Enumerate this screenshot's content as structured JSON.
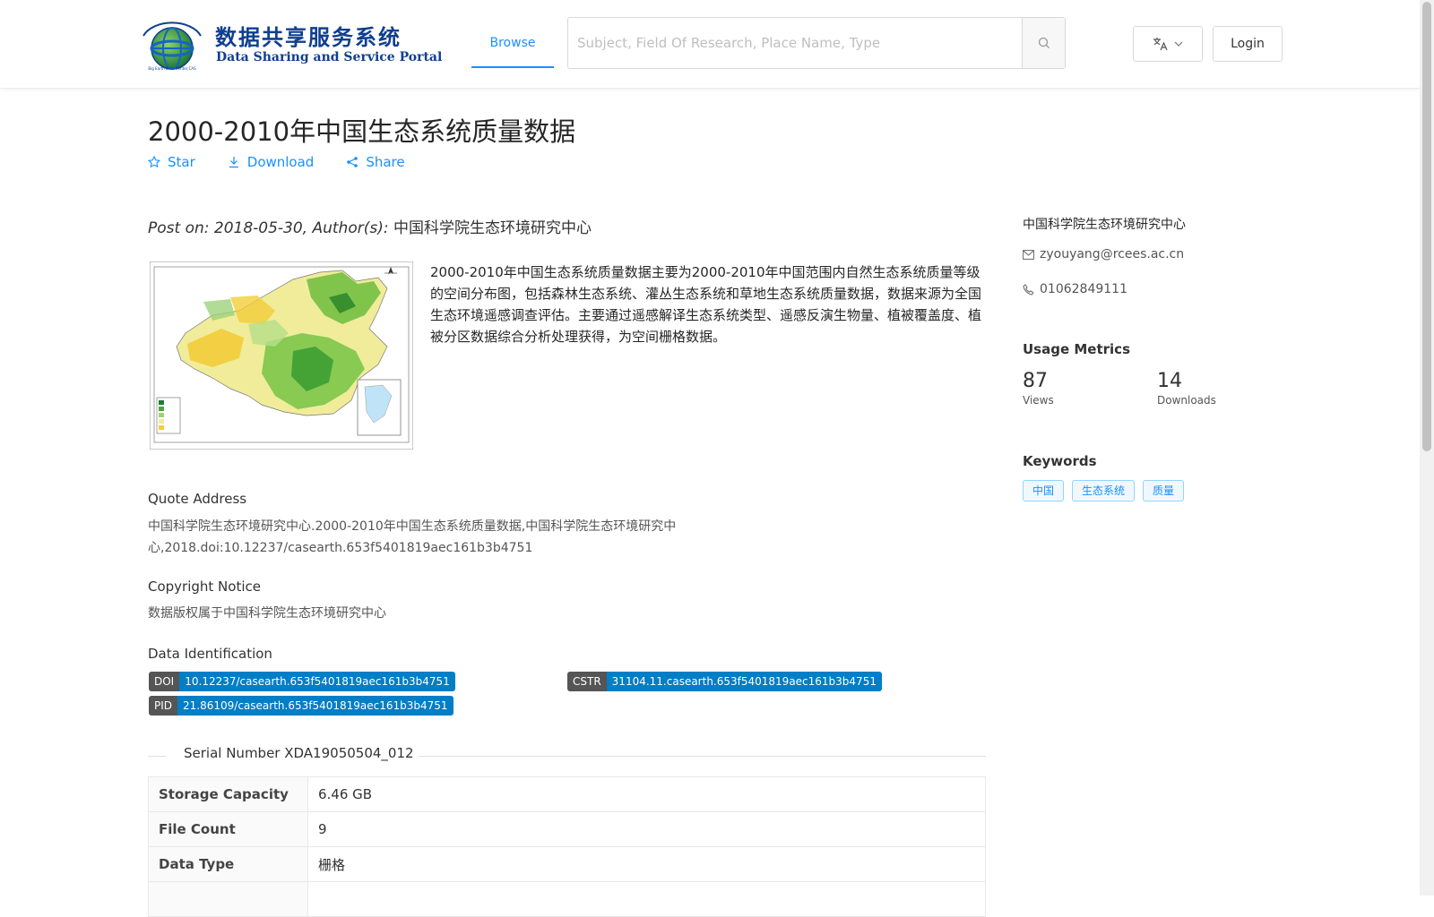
{
  "header": {
    "logo_cn": "数据共享服务系统",
    "logo_en": "Data Sharing and Service Portal",
    "logo_ring_text": "地球大数据科学数据中心",
    "nav_browse": "Browse",
    "search_placeholder": "Subject, Field Of Research, Place Name, Type",
    "login_label": "Login"
  },
  "dataset": {
    "title": "2000-2010年中国生态系统质量数据",
    "actions": {
      "star": "Star",
      "download": "Download",
      "share": "Share"
    },
    "post_prefix": "Post on: 2018-05-30, Author(s): ",
    "author": "中国科学院生态环境研究中心",
    "description": "2000-2010年中国生态系统质量数据主要为2000-2010年中国范围内自然生态系统质量等级的空间分布图，包括森林生态系统、灌丛生态系统和草地生态系统质量数据，数据来源为全国生态环境遥感调查评估。主要通过遥感解译生态系统类型、遥感反演生物量、植被覆盖度、植被分区数据综合分析处理获得，为空间栅格数据。",
    "quote_label": "Quote Address",
    "quote_text": "中国科学院生态环境研究中心.2000-2010年中国生态系统质量数据,中国科学院生态环境研究中心,2018.doi:10.12237/casearth.653f5401819aec161b3b4751",
    "copyright_label": "Copyright Notice",
    "copyright_text": "数据版权属于中国科学院生态环境研究中心",
    "identification_label": "Data Identification",
    "identifiers": {
      "doi_key": "DOI",
      "doi_value": "10.12237/casearth.653f5401819aec161b3b4751",
      "cstr_key": "CSTR",
      "cstr_value": "31104.11.casearth.653f5401819aec161b3b4751",
      "pid_key": "PID",
      "pid_value": "21.86109/casearth.653f5401819aec161b3b4751"
    },
    "serial_number": "Serial Number XDA19050504_012",
    "info_rows": [
      {
        "key": "Storage Capacity",
        "value": "6.46 GB"
      },
      {
        "key": "File Count",
        "value": "9"
      },
      {
        "key": "Data Type",
        "value": "栅格"
      }
    ]
  },
  "sidebar": {
    "org": "中国科学院生态环境研究中心",
    "email": "zyouyang@rcees.ac.cn",
    "phone": "01062849111",
    "metrics_heading": "Usage Metrics",
    "views_value": "87",
    "views_label": "Views",
    "downloads_value": "14",
    "downloads_label": "Downloads",
    "keywords_heading": "Keywords",
    "keywords": [
      "中国",
      "生态系统",
      "质量"
    ]
  },
  "map": {
    "legend": [
      "较差",
      "良好",
      "中等",
      "较差",
      "差"
    ]
  },
  "colors": {
    "accent": "#1890ff",
    "badge_key": "#555555",
    "badge_value": "#007ec6",
    "logo_blue": "#0f3f8f"
  },
  "icons": [
    "search-icon",
    "translate-icon",
    "chevron-down-icon",
    "star-icon",
    "download-icon",
    "share-icon",
    "mail-icon",
    "phone-icon"
  ]
}
